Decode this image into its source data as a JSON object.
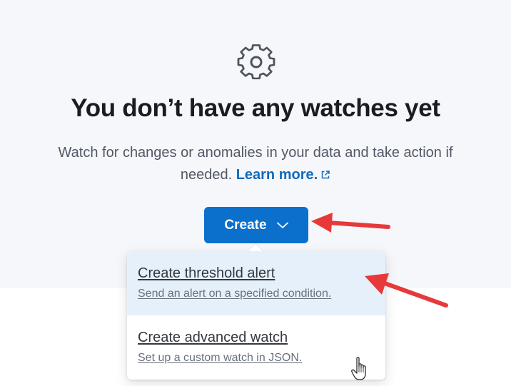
{
  "empty_state": {
    "icon": "gear-icon",
    "title": "You don’t have any watches yet",
    "description": "Watch for changes or anomalies in your data and take action if needed.",
    "learn_more_label": "Learn more.",
    "external_link_icon": "external-link-icon"
  },
  "create_button": {
    "label": "Create",
    "icon": "chevron-down-icon"
  },
  "create_menu": {
    "items": [
      {
        "title": "Create threshold alert",
        "description": "Send an alert on a specified condition.",
        "highlighted": true
      },
      {
        "title": "Create advanced watch",
        "description": "Set up a custom watch in JSON.",
        "highlighted": false
      }
    ]
  },
  "annotations": {
    "arrow_color": "#e8393a"
  },
  "colors": {
    "primary": "#0b70cc",
    "link": "#0f6bbd",
    "panel_background": "#f6f7fa",
    "menu_highlight": "#e6f0fa"
  }
}
